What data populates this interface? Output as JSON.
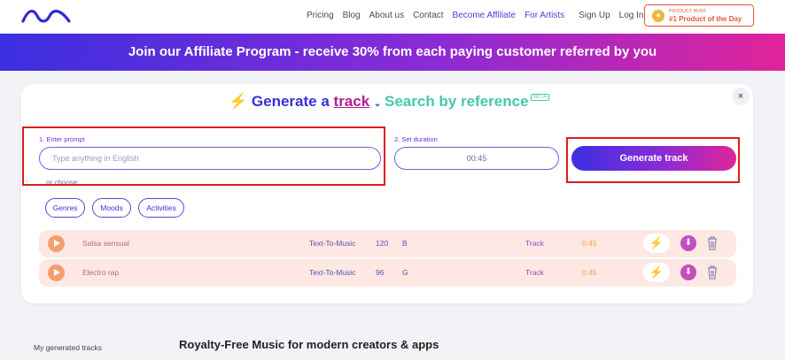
{
  "nav": {
    "links": [
      "Pricing",
      "Blog",
      "About us",
      "Contact",
      "Become Affiliate",
      "For Artists",
      "Sign Up",
      "Log In"
    ],
    "badge_small": "PRODUCT HUNT",
    "badge_big": "#1 Product of the Day"
  },
  "banner": {
    "text": "Join our Affiliate Program - receive 30% from each paying customer referred by you"
  },
  "generator": {
    "tab_generate_prefix": "Generate a",
    "tab_generate_word": "track",
    "tab_search": "Search by reference",
    "beta": "BETA",
    "close": "×",
    "prompt_label": "1. Enter prompt",
    "prompt_placeholder": "Type anything in English",
    "duration_label": "2. Set duration",
    "duration_value": "00:45",
    "generate_button": "Generate track",
    "or_choose": "or choose:",
    "chips": [
      "Genres",
      "Moods",
      "Activities"
    ]
  },
  "tracks": [
    {
      "name": "Salsa sensual",
      "type": "Text-To-Music",
      "bpm": "120",
      "key": "B",
      "kind": "Track",
      "duration": "0:45"
    },
    {
      "name": "Electro rap",
      "type": "Text-To-Music",
      "bpm": "96",
      "key": "G",
      "kind": "Track",
      "duration": "0:45"
    }
  ],
  "footer": {
    "left": "My generated tracks",
    "right": "Royalty-Free Music for modern creators & apps"
  },
  "colors": {
    "brand": "#3b2fe0",
    "accent_pink": "#e0249a",
    "teal": "#46c9a8",
    "highlight": "#e01b1b"
  }
}
